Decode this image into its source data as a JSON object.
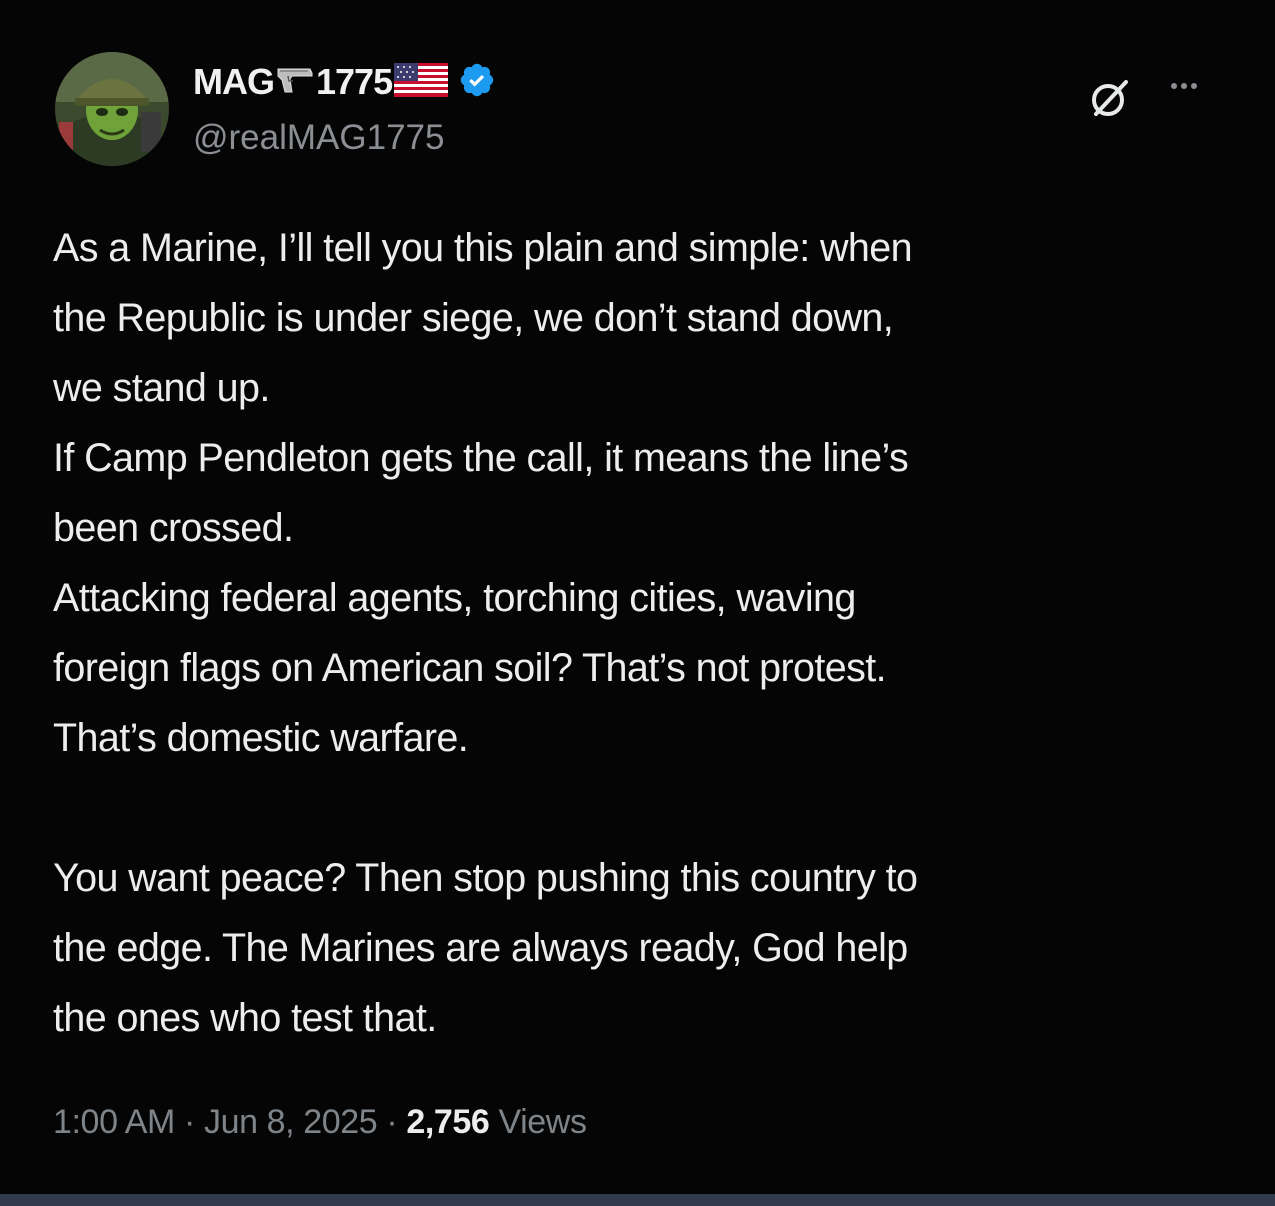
{
  "tweet": {
    "author": {
      "name_prefix": "MAG",
      "name_suffix": "1775",
      "handle": "@realMAG1775"
    },
    "body_lines": [
      "As a Marine, I’ll tell you this plain and simple: when",
      "the Republic is under siege, we don’t stand down,",
      "we stand up.",
      "If Camp Pendleton gets the call, it means the line’s",
      "been crossed.",
      "Attacking federal agents, torching cities, waving",
      "foreign flags on American soil? That’s not protest.",
      "That’s domestic warfare.",
      "",
      "You want peace? Then stop pushing this country to",
      "the edge. The Marines are always ready, God help",
      "the ones who test that."
    ],
    "meta": {
      "time": "1:00 AM",
      "separator": "·",
      "date": "Jun 8, 2025",
      "views_count": "2,756",
      "views_label": "Views"
    }
  },
  "icons": {
    "verified": "verified-badge-icon",
    "grok": "grok-icon",
    "more": "more-options-icon",
    "gun": "handgun-emoji-icon",
    "flag": "us-flag-emoji-icon"
  },
  "colors": {
    "background": "#050505",
    "text": "#ededed",
    "secondary_text": "#7f8489",
    "verified_blue": "#1d9bf0"
  }
}
